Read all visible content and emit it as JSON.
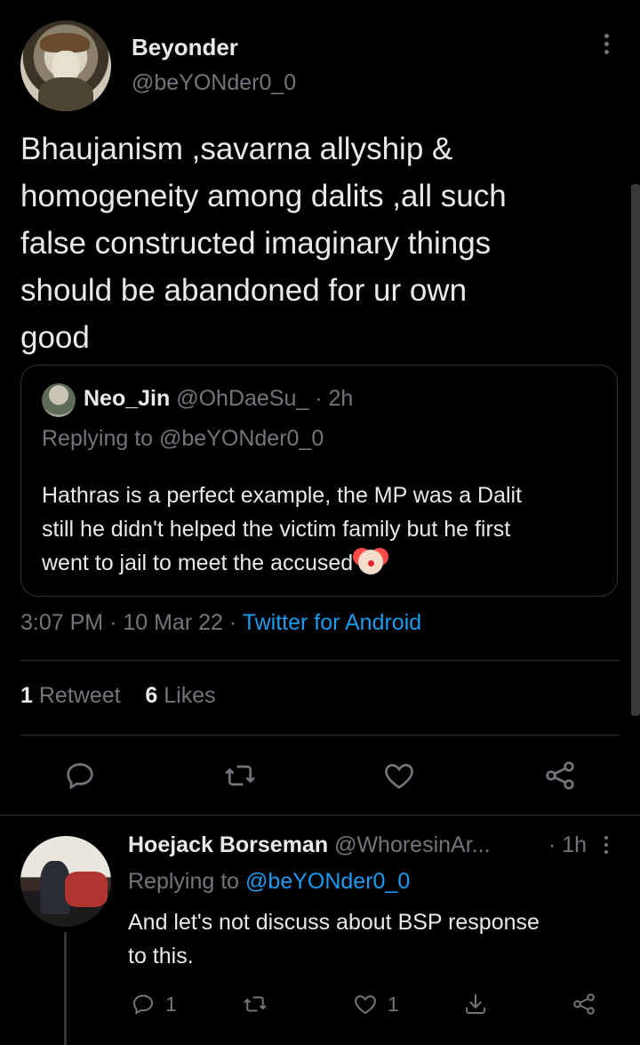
{
  "tweet": {
    "author_name": "Beyonder",
    "author_handle": "@beYONder0_0",
    "text": "Bhaujanism ,savarna allyship &\nhomogeneity among dalits ,all such\nfalse constructed imaginary things\nshould be abandoned for ur own\ngood",
    "time": "3:07 PM",
    "date": "10 Mar 22",
    "source": "Twitter for Android",
    "retweet_count": "1",
    "retweet_label": "Retweet",
    "like_count": "6",
    "like_label": "Likes"
  },
  "quote": {
    "author_name": "Neo_Jin",
    "author_handle": "@OhDaeSu_",
    "age": "2h",
    "replying_to": "Replying to @beYONder0_0",
    "text": "Hathras is a perfect example, the MP was a Dalit\nstill he didn't helped the victim family but he first\nwent to jail to meet the accused",
    "emoji": "clown-face"
  },
  "reply": {
    "author_name": "Hoejack Borseman",
    "author_handle": "@WhoresinAr...",
    "age": "1h",
    "replying_prefix": "Replying to",
    "replying_handle": "@beYONder0_0",
    "text": "And let's not discuss about BSP response\nto this.",
    "reply_count": "1",
    "like_count": "1"
  },
  "icons": {
    "reply": "comment-icon",
    "retweet": "retweet-icon",
    "like": "heart-icon",
    "share": "share-icon",
    "more": "more-vertical-icon"
  },
  "colors": {
    "background": "#000000",
    "text": "#e7e9ea",
    "muted": "#71767b",
    "link": "#1d9bf0",
    "divider": "#2f3336"
  }
}
